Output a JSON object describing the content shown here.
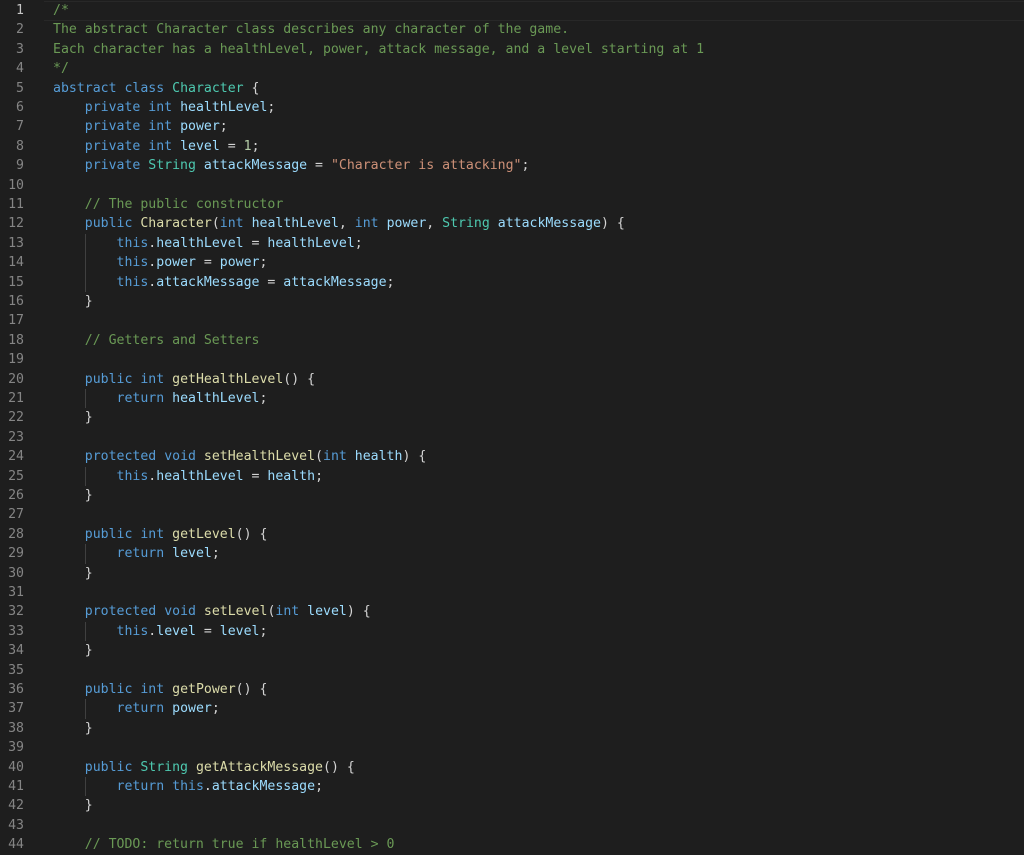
{
  "editor": {
    "active_line": 1,
    "lines": [
      {
        "n": "1",
        "tokens": [
          [
            "c",
            "/*"
          ]
        ]
      },
      {
        "n": "2",
        "tokens": [
          [
            "c",
            "The abstract Character class describes any character of the game."
          ]
        ]
      },
      {
        "n": "3",
        "tokens": [
          [
            "c",
            "Each character has a healthLevel, power, attack message, and a level starting at 1"
          ]
        ]
      },
      {
        "n": "4",
        "tokens": [
          [
            "c",
            "*/"
          ]
        ]
      },
      {
        "n": "5",
        "tokens": [
          [
            "k",
            "abstract"
          ],
          [
            "p",
            " "
          ],
          [
            "k",
            "class"
          ],
          [
            "p",
            " "
          ],
          [
            "t",
            "Character"
          ],
          [
            "p",
            " {"
          ]
        ]
      },
      {
        "n": "6",
        "tokens": [
          [
            "p",
            "    "
          ],
          [
            "k",
            "private"
          ],
          [
            "p",
            " "
          ],
          [
            "k",
            "int"
          ],
          [
            "p",
            " "
          ],
          [
            "v",
            "healthLevel"
          ],
          [
            "p",
            ";"
          ]
        ]
      },
      {
        "n": "7",
        "tokens": [
          [
            "p",
            "    "
          ],
          [
            "k",
            "private"
          ],
          [
            "p",
            " "
          ],
          [
            "k",
            "int"
          ],
          [
            "p",
            " "
          ],
          [
            "v",
            "power"
          ],
          [
            "p",
            ";"
          ]
        ]
      },
      {
        "n": "8",
        "tokens": [
          [
            "p",
            "    "
          ],
          [
            "k",
            "private"
          ],
          [
            "p",
            " "
          ],
          [
            "k",
            "int"
          ],
          [
            "p",
            " "
          ],
          [
            "v",
            "level"
          ],
          [
            "p",
            " = "
          ],
          [
            "n",
            "1"
          ],
          [
            "p",
            ";"
          ]
        ]
      },
      {
        "n": "9",
        "tokens": [
          [
            "p",
            "    "
          ],
          [
            "k",
            "private"
          ],
          [
            "p",
            " "
          ],
          [
            "t",
            "String"
          ],
          [
            "p",
            " "
          ],
          [
            "v",
            "attackMessage"
          ],
          [
            "p",
            " = "
          ],
          [
            "s",
            "\"Character is attacking\""
          ],
          [
            "p",
            ";"
          ]
        ]
      },
      {
        "n": "10",
        "tokens": []
      },
      {
        "n": "11",
        "tokens": [
          [
            "p",
            "    "
          ],
          [
            "c",
            "// The public constructor"
          ]
        ]
      },
      {
        "n": "12",
        "tokens": [
          [
            "p",
            "    "
          ],
          [
            "k",
            "public"
          ],
          [
            "p",
            " "
          ],
          [
            "f",
            "Character"
          ],
          [
            "p",
            "("
          ],
          [
            "k",
            "int"
          ],
          [
            "p",
            " "
          ],
          [
            "v",
            "healthLevel"
          ],
          [
            "p",
            ", "
          ],
          [
            "k",
            "int"
          ],
          [
            "p",
            " "
          ],
          [
            "v",
            "power"
          ],
          [
            "p",
            ", "
          ],
          [
            "t",
            "String"
          ],
          [
            "p",
            " "
          ],
          [
            "v",
            "attackMessage"
          ],
          [
            "p",
            ") {"
          ]
        ]
      },
      {
        "n": "13",
        "tokens": [
          [
            "p",
            "        "
          ],
          [
            "k",
            "this"
          ],
          [
            "p",
            "."
          ],
          [
            "v",
            "healthLevel"
          ],
          [
            "p",
            " = "
          ],
          [
            "v",
            "healthLevel"
          ],
          [
            "p",
            ";"
          ]
        ]
      },
      {
        "n": "14",
        "tokens": [
          [
            "p",
            "        "
          ],
          [
            "k",
            "this"
          ],
          [
            "p",
            "."
          ],
          [
            "v",
            "power"
          ],
          [
            "p",
            " = "
          ],
          [
            "v",
            "power"
          ],
          [
            "p",
            ";"
          ]
        ]
      },
      {
        "n": "15",
        "tokens": [
          [
            "p",
            "        "
          ],
          [
            "k",
            "this"
          ],
          [
            "p",
            "."
          ],
          [
            "v",
            "attackMessage"
          ],
          [
            "p",
            " = "
          ],
          [
            "v",
            "attackMessage"
          ],
          [
            "p",
            ";"
          ]
        ]
      },
      {
        "n": "16",
        "tokens": [
          [
            "p",
            "    }"
          ]
        ]
      },
      {
        "n": "17",
        "tokens": []
      },
      {
        "n": "18",
        "tokens": [
          [
            "p",
            "    "
          ],
          [
            "c",
            "// Getters and Setters"
          ]
        ]
      },
      {
        "n": "19",
        "tokens": []
      },
      {
        "n": "20",
        "tokens": [
          [
            "p",
            "    "
          ],
          [
            "k",
            "public"
          ],
          [
            "p",
            " "
          ],
          [
            "k",
            "int"
          ],
          [
            "p",
            " "
          ],
          [
            "f",
            "getHealthLevel"
          ],
          [
            "p",
            "() {"
          ]
        ]
      },
      {
        "n": "21",
        "tokens": [
          [
            "p",
            "        "
          ],
          [
            "k",
            "return"
          ],
          [
            "p",
            " "
          ],
          [
            "v",
            "healthLevel"
          ],
          [
            "p",
            ";"
          ]
        ]
      },
      {
        "n": "22",
        "tokens": [
          [
            "p",
            "    }"
          ]
        ]
      },
      {
        "n": "23",
        "tokens": []
      },
      {
        "n": "24",
        "tokens": [
          [
            "p",
            "    "
          ],
          [
            "k",
            "protected"
          ],
          [
            "p",
            " "
          ],
          [
            "k",
            "void"
          ],
          [
            "p",
            " "
          ],
          [
            "f",
            "setHealthLevel"
          ],
          [
            "p",
            "("
          ],
          [
            "k",
            "int"
          ],
          [
            "p",
            " "
          ],
          [
            "v",
            "health"
          ],
          [
            "p",
            ") {"
          ]
        ]
      },
      {
        "n": "25",
        "tokens": [
          [
            "p",
            "        "
          ],
          [
            "k",
            "this"
          ],
          [
            "p",
            "."
          ],
          [
            "v",
            "healthLevel"
          ],
          [
            "p",
            " = "
          ],
          [
            "v",
            "health"
          ],
          [
            "p",
            ";"
          ]
        ]
      },
      {
        "n": "26",
        "tokens": [
          [
            "p",
            "    }"
          ]
        ]
      },
      {
        "n": "27",
        "tokens": []
      },
      {
        "n": "28",
        "tokens": [
          [
            "p",
            "    "
          ],
          [
            "k",
            "public"
          ],
          [
            "p",
            " "
          ],
          [
            "k",
            "int"
          ],
          [
            "p",
            " "
          ],
          [
            "f",
            "getLevel"
          ],
          [
            "p",
            "() {"
          ]
        ]
      },
      {
        "n": "29",
        "tokens": [
          [
            "p",
            "        "
          ],
          [
            "k",
            "return"
          ],
          [
            "p",
            " "
          ],
          [
            "v",
            "level"
          ],
          [
            "p",
            ";"
          ]
        ]
      },
      {
        "n": "30",
        "tokens": [
          [
            "p",
            "    }"
          ]
        ]
      },
      {
        "n": "31",
        "tokens": []
      },
      {
        "n": "32",
        "tokens": [
          [
            "p",
            "    "
          ],
          [
            "k",
            "protected"
          ],
          [
            "p",
            " "
          ],
          [
            "k",
            "void"
          ],
          [
            "p",
            " "
          ],
          [
            "f",
            "setLevel"
          ],
          [
            "p",
            "("
          ],
          [
            "k",
            "int"
          ],
          [
            "p",
            " "
          ],
          [
            "v",
            "level"
          ],
          [
            "p",
            ") {"
          ]
        ]
      },
      {
        "n": "33",
        "tokens": [
          [
            "p",
            "        "
          ],
          [
            "k",
            "this"
          ],
          [
            "p",
            "."
          ],
          [
            "v",
            "level"
          ],
          [
            "p",
            " = "
          ],
          [
            "v",
            "level"
          ],
          [
            "p",
            ";"
          ]
        ]
      },
      {
        "n": "34",
        "tokens": [
          [
            "p",
            "    }"
          ]
        ]
      },
      {
        "n": "35",
        "tokens": []
      },
      {
        "n": "36",
        "tokens": [
          [
            "p",
            "    "
          ],
          [
            "k",
            "public"
          ],
          [
            "p",
            " "
          ],
          [
            "k",
            "int"
          ],
          [
            "p",
            " "
          ],
          [
            "f",
            "getPower"
          ],
          [
            "p",
            "() {"
          ]
        ]
      },
      {
        "n": "37",
        "tokens": [
          [
            "p",
            "        "
          ],
          [
            "k",
            "return"
          ],
          [
            "p",
            " "
          ],
          [
            "v",
            "power"
          ],
          [
            "p",
            ";"
          ]
        ]
      },
      {
        "n": "38",
        "tokens": [
          [
            "p",
            "    }"
          ]
        ]
      },
      {
        "n": "39",
        "tokens": []
      },
      {
        "n": "40",
        "tokens": [
          [
            "p",
            "    "
          ],
          [
            "k",
            "public"
          ],
          [
            "p",
            " "
          ],
          [
            "t",
            "String"
          ],
          [
            "p",
            " "
          ],
          [
            "f",
            "getAttackMessage"
          ],
          [
            "p",
            "() {"
          ]
        ]
      },
      {
        "n": "41",
        "tokens": [
          [
            "p",
            "        "
          ],
          [
            "k",
            "return"
          ],
          [
            "p",
            " "
          ],
          [
            "k",
            "this"
          ],
          [
            "p",
            "."
          ],
          [
            "v",
            "attackMessage"
          ],
          [
            "p",
            ";"
          ]
        ]
      },
      {
        "n": "42",
        "tokens": [
          [
            "p",
            "    }"
          ]
        ]
      },
      {
        "n": "43",
        "tokens": []
      },
      {
        "n": "44",
        "tokens": [
          [
            "p",
            "    "
          ],
          [
            "c",
            "// TODO: return true if healthLevel > 0"
          ]
        ]
      }
    ]
  },
  "colors": {
    "background": "#1e1e1e",
    "keyword": "#569cd6",
    "type": "#4ec9b0",
    "variable": "#9cdcfe",
    "function": "#dcdcaa",
    "string": "#ce9178",
    "number": "#b5cea8",
    "comment": "#6a9955",
    "plain": "#d4d4d4",
    "line_number": "#858585"
  }
}
